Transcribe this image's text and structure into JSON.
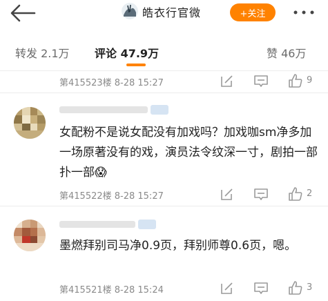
{
  "header": {
    "account_name": "皓衣行官微",
    "follow_label": "+关注"
  },
  "tabs": {
    "repost": "转发 2.1万",
    "comment": "评论 47.9万",
    "like": "赞 46万"
  },
  "comments": [
    {
      "floor_time": "第415523楼 8-28 15:27",
      "likes": "9"
    },
    {
      "floor_time": "第415522楼 8-28 15:27",
      "likes": "2",
      "text": "女配粉不是说女配没有加戏吗？加戏咖sm净多加一场原著没有的戏，演员法令纹深一寸，剧拍一部扑一部😱"
    },
    {
      "floor_time": "第415521楼 8-28 15:24",
      "likes": "3",
      "text": "墨燃拜别司马净0.9页，拜别师尊0.6页，嗯。"
    }
  ],
  "colors": {
    "accent": "#ff8200",
    "meta_text": "#8a8a8a",
    "icon": "#9a9a9a"
  },
  "icons": [
    "back-arrow-icon",
    "more-dots-icon",
    "edit-icon",
    "reply-icon",
    "thumb-up-icon"
  ]
}
